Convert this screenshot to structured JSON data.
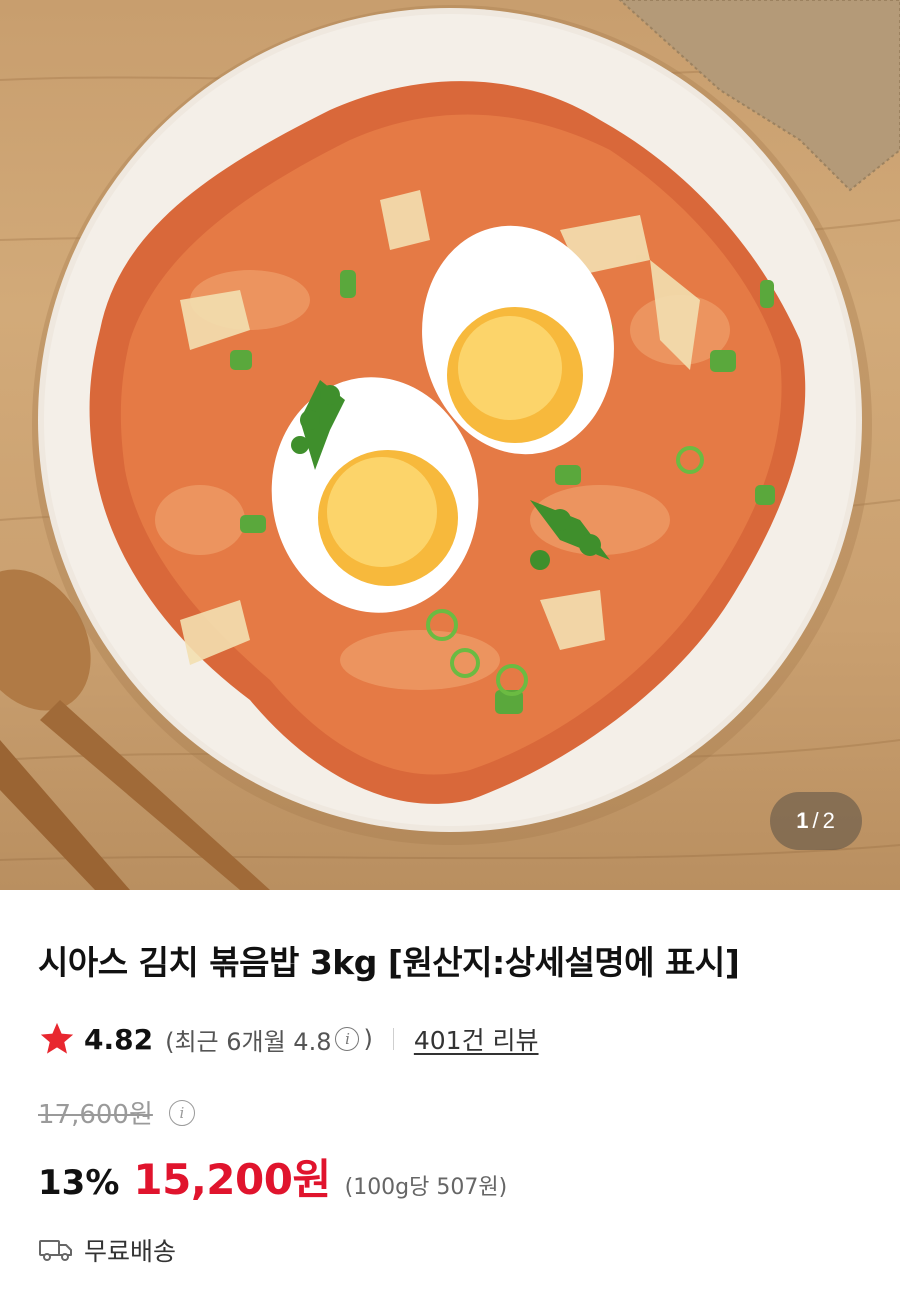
{
  "gallery": {
    "image_alt": "김치 볶음밥",
    "counter_current": "1",
    "counter_separator": "/",
    "counter_total": "2"
  },
  "product": {
    "title": "시아스 김치 볶음밥 3kg [원산지:상세설명에 표시]",
    "rating": "4.82",
    "recent_open": "(최근 6개월 4.8",
    "info_glyph": "i",
    "recent_close": ")",
    "review_count_label": "401건 리뷰",
    "original_price": "17,600원",
    "discount": "13%",
    "sale_price": "15,200원",
    "unit_price": "(100g당 507원)",
    "shipping": "무료배송"
  },
  "icons": {
    "star": "star-icon",
    "info": "info-icon",
    "truck": "truck-icon"
  },
  "colors": {
    "accent_red": "#e0142d",
    "star_red": "#e8272f",
    "strike_grey": "#9a9a9a"
  }
}
